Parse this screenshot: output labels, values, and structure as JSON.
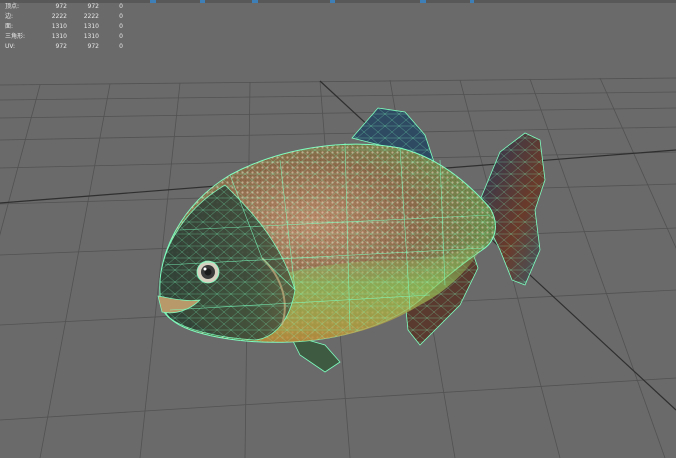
{
  "viewport": {
    "background": "#6a6a6a",
    "grid_color": "#4a4a4a",
    "axis_color": "#2e2e2e",
    "wireframe_color": "#7dffc0",
    "model": "piranha-fish-icon"
  },
  "stats": {
    "rows": [
      {
        "label": "顶点:",
        "v1": "972",
        "v2": "972",
        "v3": "0"
      },
      {
        "label": "边:",
        "v1": "2222",
        "v2": "2222",
        "v3": "0"
      },
      {
        "label": "面:",
        "v1": "1310",
        "v2": "1310",
        "v3": "0"
      },
      {
        "label": "三角形:",
        "v1": "1310",
        "v2": "1310",
        "v3": "0"
      },
      {
        "label": "UV:",
        "v1": "972",
        "v2": "972",
        "v3": "0"
      }
    ]
  }
}
